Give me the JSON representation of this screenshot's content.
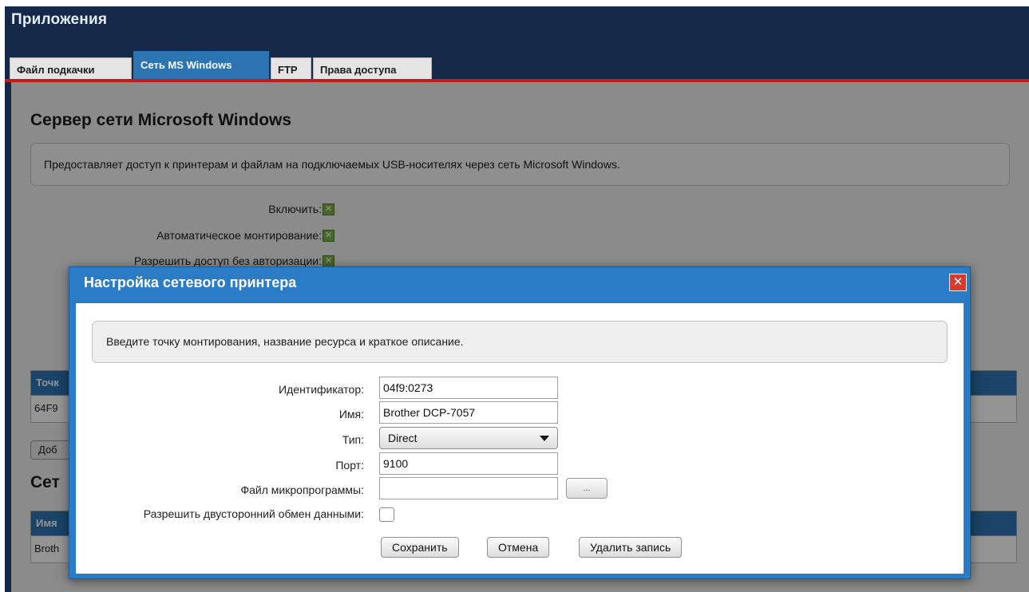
{
  "app": {
    "title": "Приложения"
  },
  "tabs": [
    {
      "label": "Файл подкачки",
      "active": false
    },
    {
      "label": "Сеть MS Windows",
      "active": true
    },
    {
      "label": "FTP",
      "active": false
    },
    {
      "label": "Права доступа",
      "active": false
    }
  ],
  "page": {
    "section_title": "Сервер сети Microsoft Windows",
    "info_text": "Предоставляет доступ к принтерам и файлам на подключаемых USB-носителях через сеть Microsoft Windows.",
    "options": [
      {
        "label": "Включить:",
        "checked": true
      },
      {
        "label": "Автоматическое монтирование:",
        "checked": true
      },
      {
        "label": "Разрешить доступ без авторизации:",
        "checked": true
      }
    ],
    "table1_header_partial": "Точк",
    "table1_row_partial": "64F9",
    "add_button_partial": "Доб",
    "section2_title_partial": "Сет",
    "table2_header_partial": "Имя",
    "table2_row_partial": "Broth"
  },
  "dialog": {
    "title": "Настройка сетевого принтера",
    "info_text": "Введите точку монтирования, название ресурса и краткое описание.",
    "fields": {
      "identifier_label": "Идентификатор:",
      "identifier_value": "04f9:0273",
      "name_label": "Имя:",
      "name_value": "Brother DCP-7057",
      "type_label": "Тип:",
      "type_value": "Direct",
      "port_label": "Порт:",
      "port_value": "9100",
      "firmware_label": "Файл микропрограммы:",
      "firmware_value": "",
      "browse_label": "...",
      "bidirectional_label": "Разрешить двусторонний обмен данными:",
      "bidirectional_checked": false
    },
    "buttons": {
      "save": "Сохранить",
      "cancel": "Отмена",
      "delete": "Удалить запись"
    }
  },
  "colors": {
    "header_bg": "#142849",
    "accent_blue": "#2b7cc7",
    "tab_underline": "#c51a1a",
    "check_green": "#7cb143"
  }
}
